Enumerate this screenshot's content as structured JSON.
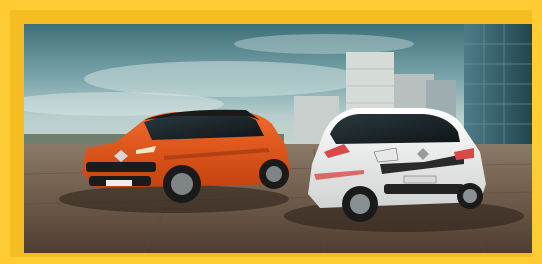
{
  "frame": {
    "border_color": "#ffcc33"
  },
  "photo": {
    "icon": "car-advertisement-photo",
    "subjects": [
      "orange-crossover-suv",
      "white-city-hatchback"
    ],
    "colors": {
      "sky_top": "#3e6f78",
      "sky_mid": "#9dc0c4",
      "ground": "#6f5b4a",
      "car_left": "#e2521c",
      "car_right": "#eef0ef"
    }
  }
}
